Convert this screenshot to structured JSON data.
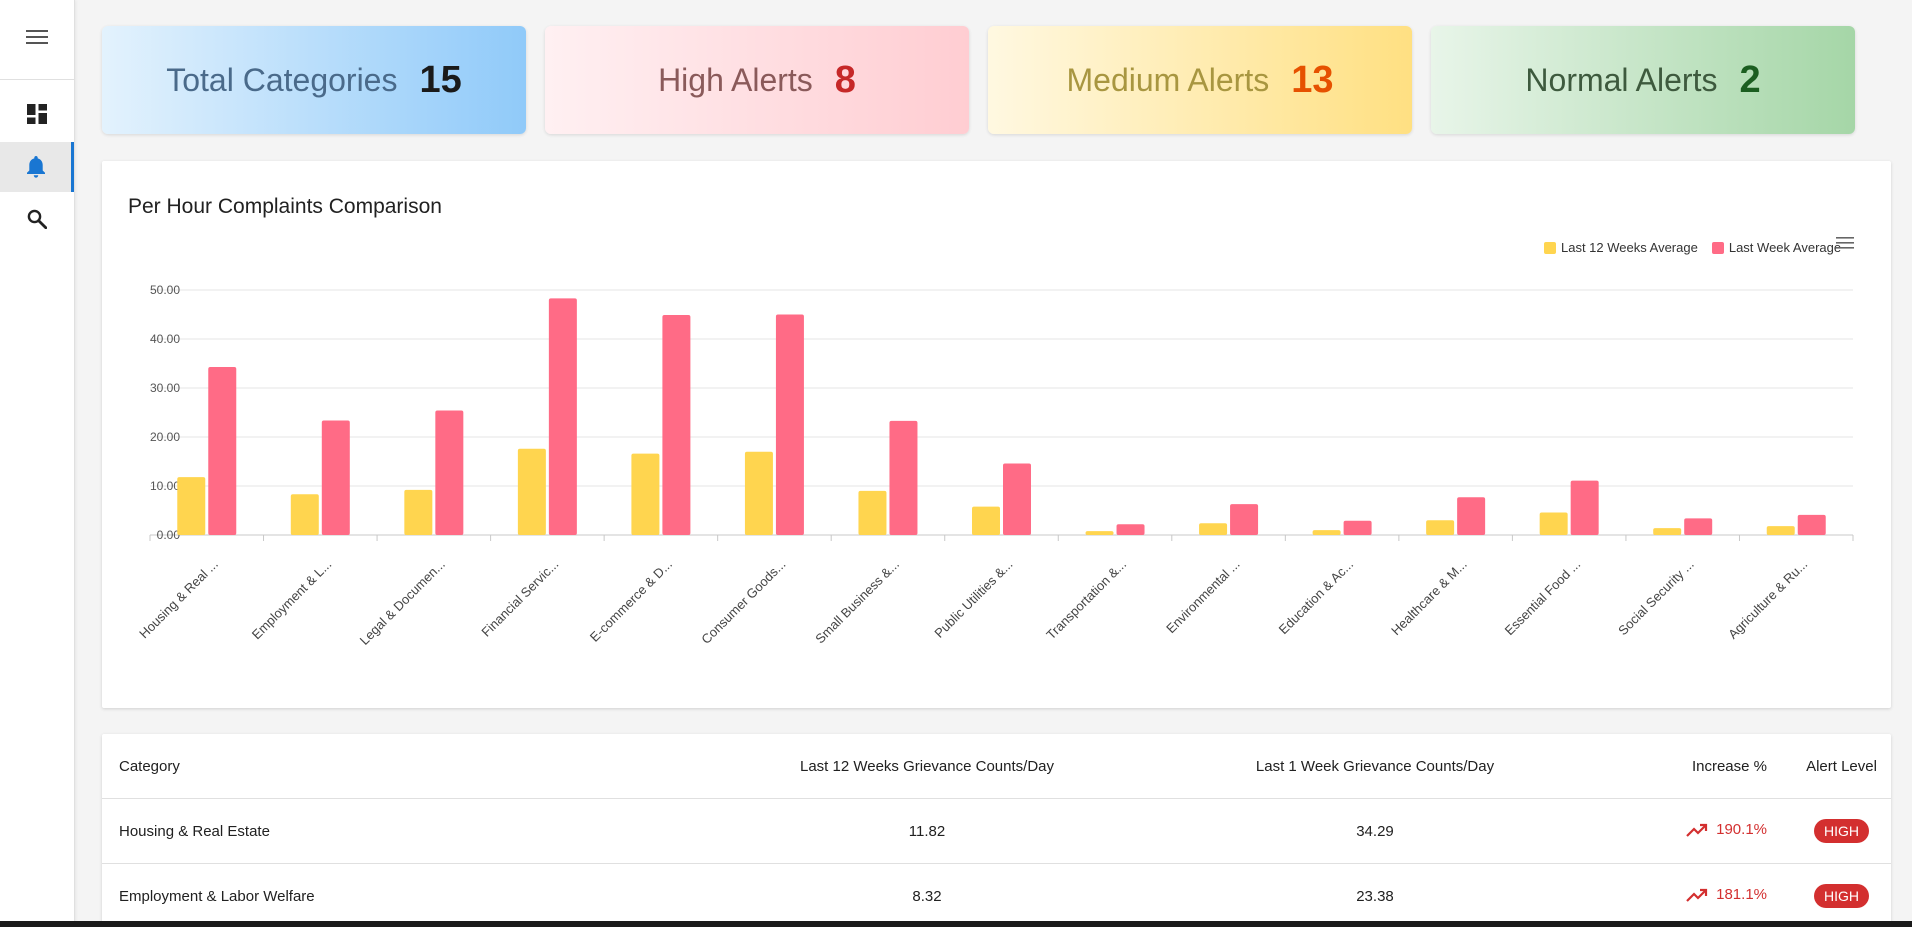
{
  "nav": {
    "menu_icon": "menu-icon",
    "items": [
      {
        "icon": "dashboard-icon",
        "active": false
      },
      {
        "icon": "bell-icon",
        "active": true
      },
      {
        "icon": "search-icon",
        "active": false
      }
    ]
  },
  "summary": [
    {
      "label": "Total Categories",
      "value": "15",
      "label_color": "#4a6a8a",
      "value_color": "#1a1a1a",
      "bg": "#9fd0f8"
    },
    {
      "label": "High Alerts",
      "value": "8",
      "label_color": "#8a5a5a",
      "value_color": "#c62828",
      "bg": "#ffd0d8"
    },
    {
      "label": "Medium Alerts",
      "value": "13",
      "label_color": "#a89640",
      "value_color": "#e65100",
      "bg": "#ffe28f"
    },
    {
      "label": "Normal Alerts",
      "value": "2",
      "label_color": "#3e5a3e",
      "value_color": "#1b5e20",
      "bg": "#a5d6a7"
    }
  ],
  "chart_data": {
    "type": "bar",
    "title": "Per Hour Complaints Comparison",
    "categories": [
      "Housing & Real ...",
      "Employment & L...",
      "Legal & Documen...",
      "Financial Servic...",
      "E-commerce & D...",
      "Consumer Goods...",
      "Small Business &...",
      "Public Utilities &...",
      "Transportation &...",
      "Environmental ...",
      "Education & Ac...",
      "Healthcare & M...",
      "Essential Food ...",
      "Social Security ...",
      "Agriculture & Ru..."
    ],
    "series": [
      {
        "name": "Last 12 Weeks Average",
        "color": "#ffd54f",
        "values": [
          11.82,
          8.32,
          9.2,
          17.6,
          16.6,
          17.0,
          9.0,
          5.8,
          0.8,
          2.4,
          1.0,
          3.0,
          4.6,
          1.4,
          1.8
        ]
      },
      {
        "name": "Last Week Average",
        "color": "#ff6b86",
        "values": [
          34.29,
          23.38,
          25.4,
          48.3,
          44.9,
          45.0,
          23.3,
          14.6,
          2.2,
          6.3,
          2.9,
          7.7,
          11.1,
          3.4,
          4.1
        ]
      }
    ],
    "ylim": [
      0,
      50
    ],
    "yticks": [
      "0.00",
      "10.00",
      "20.00",
      "30.00",
      "40.00",
      "50.00"
    ],
    "grid": true,
    "legend": "top-right"
  },
  "table": {
    "headers": [
      "Category",
      "Last 12 Weeks Grievance Counts/Day",
      "Last 1 Week Grievance Counts/Day",
      "Increase %",
      "Alert Level"
    ],
    "rows": [
      {
        "category": "Housing & Real Estate",
        "last12": "11.82",
        "last1": "34.29",
        "increase": "190.1%",
        "level": "HIGH"
      },
      {
        "category": "Employment & Labor Welfare",
        "last12": "8.32",
        "last1": "23.38",
        "increase": "181.1%",
        "level": "HIGH"
      }
    ]
  }
}
